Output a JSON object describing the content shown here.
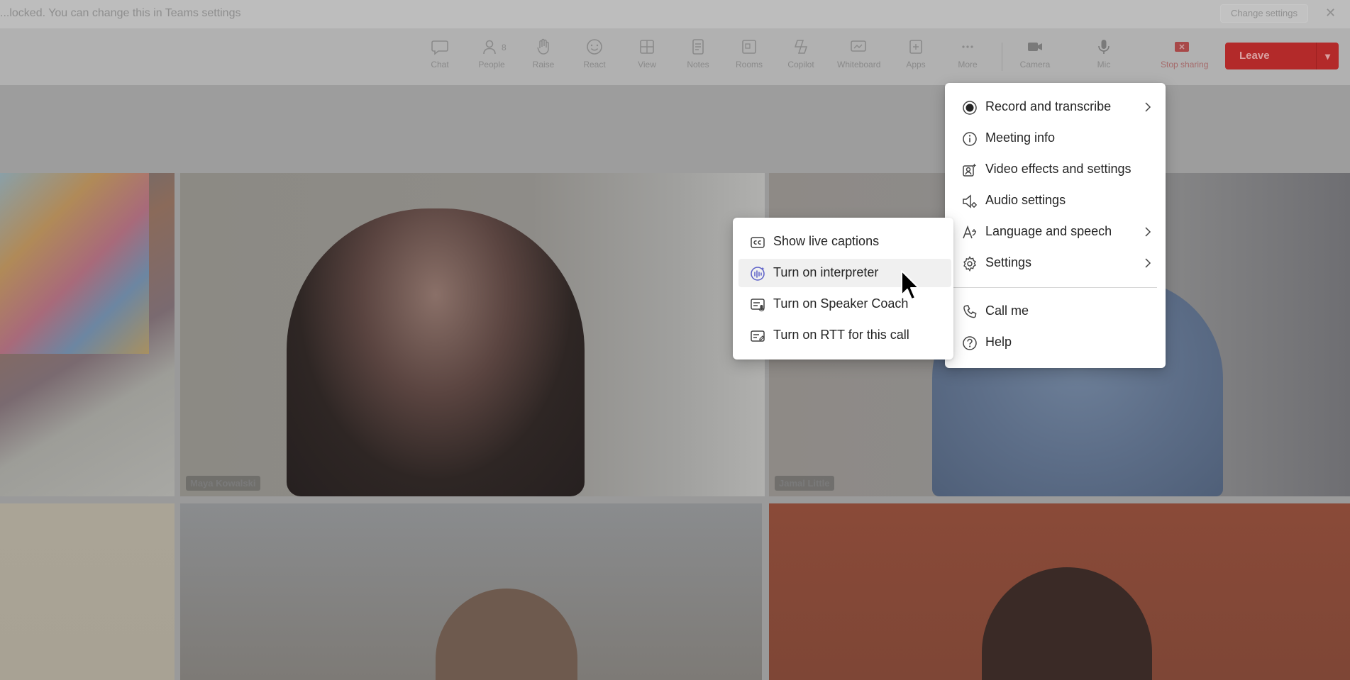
{
  "banner": {
    "text": "...locked. You can change this in Teams settings",
    "button": "Change settings",
    "close": "✕"
  },
  "toolbar": {
    "items": [
      {
        "label": "Chat",
        "icon": "chat-icon"
      },
      {
        "label": "People",
        "icon": "people-icon",
        "count": "8"
      },
      {
        "label": "Raise",
        "icon": "raise-hand-icon"
      },
      {
        "label": "React",
        "icon": "react-icon"
      },
      {
        "label": "View",
        "icon": "view-icon"
      },
      {
        "label": "Notes",
        "icon": "notes-icon"
      },
      {
        "label": "Rooms",
        "icon": "rooms-icon"
      },
      {
        "label": "Copilot",
        "icon": "copilot-icon"
      },
      {
        "label": "Whiteboard",
        "icon": "whiteboard-icon"
      },
      {
        "label": "Apps",
        "icon": "apps-icon"
      },
      {
        "label": "More",
        "icon": "more-icon"
      },
      {
        "label": "Camera",
        "icon": "camera-icon"
      },
      {
        "label": "Mic",
        "icon": "mic-icon"
      },
      {
        "label": "Stop sharing",
        "icon": "stop-sharing-icon"
      }
    ],
    "leave": "Leave"
  },
  "tiles": {
    "t2_name": "Maya Kowalski",
    "t3_name": "Jamal Little"
  },
  "main_menu": {
    "items": [
      {
        "label": "Record and transcribe",
        "icon": "record-icon",
        "submenu": true
      },
      {
        "label": "Meeting info",
        "icon": "info-icon",
        "submenu": false
      },
      {
        "label": "Video effects and settings",
        "icon": "video-effects-icon",
        "submenu": false
      },
      {
        "label": "Audio settings",
        "icon": "audio-settings-icon",
        "submenu": false
      },
      {
        "label": "Language and speech",
        "icon": "language-icon",
        "submenu": true
      },
      {
        "label": "Settings",
        "icon": "gear-icon",
        "submenu": true
      },
      {
        "label": "Call me",
        "icon": "phone-icon",
        "submenu": false
      },
      {
        "label": "Help",
        "icon": "help-icon",
        "submenu": false
      }
    ]
  },
  "sub_menu": {
    "items": [
      {
        "label": "Show live captions",
        "icon": "cc-icon"
      },
      {
        "label": "Turn on interpreter",
        "icon": "interpreter-icon",
        "hovered": true
      },
      {
        "label": "Turn on Speaker Coach",
        "icon": "speaker-coach-icon"
      },
      {
        "label": "Turn on RTT for this call",
        "icon": "rtt-icon"
      }
    ]
  }
}
